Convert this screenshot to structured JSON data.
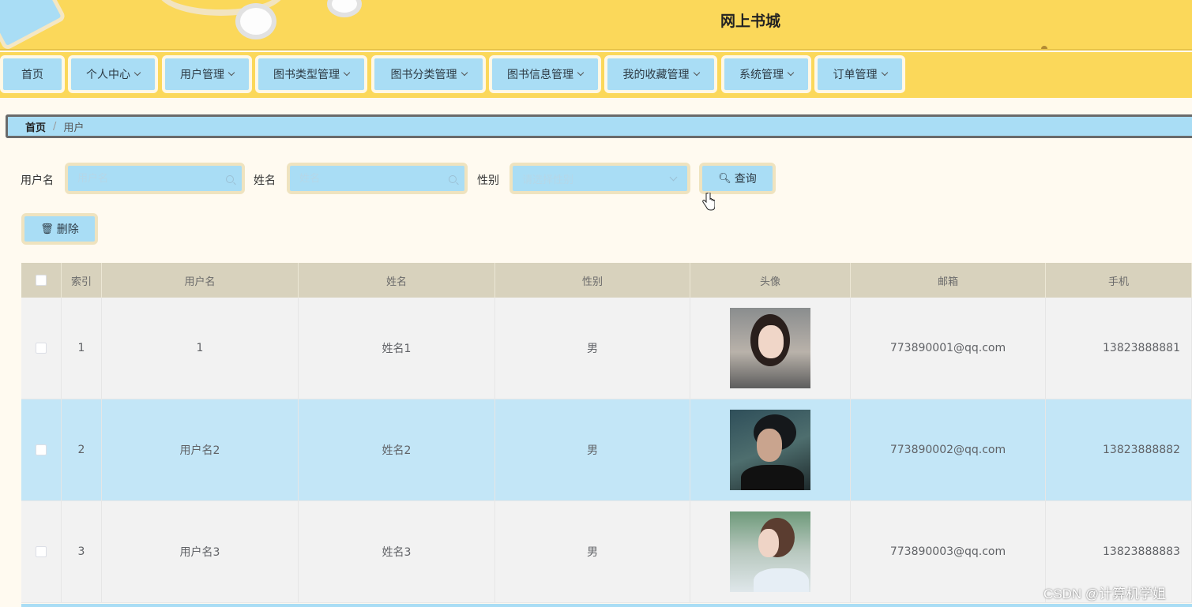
{
  "header": {
    "title": "网上书城"
  },
  "nav": [
    {
      "label": "首页",
      "dropdown": false
    },
    {
      "label": "个人中心",
      "dropdown": true
    },
    {
      "label": "用户管理",
      "dropdown": true
    },
    {
      "label": "图书类型管理",
      "dropdown": true
    },
    {
      "label": "图书分类管理",
      "dropdown": true
    },
    {
      "label": "图书信息管理",
      "dropdown": true
    },
    {
      "label": "我的收藏管理",
      "dropdown": true
    },
    {
      "label": "系统管理",
      "dropdown": true
    },
    {
      "label": "订单管理",
      "dropdown": true
    }
  ],
  "breadcrumb": {
    "home": "首页",
    "separator": "/",
    "current": "用户"
  },
  "search": {
    "username_label": "用户名",
    "username_placeholder": "用户名",
    "name_label": "姓名",
    "name_placeholder": "姓名",
    "gender_label": "性别",
    "gender_placeholder": "请选择性别",
    "query_button": "查询"
  },
  "actions": {
    "delete_button": "删除"
  },
  "table": {
    "headers": [
      "索引",
      "用户名",
      "姓名",
      "性别",
      "头像",
      "邮箱",
      "手机"
    ],
    "rows": [
      {
        "index": "1",
        "username": "1",
        "name": "姓名1",
        "gender": "男",
        "email": "773890001@qq.com",
        "phone": "13823888881"
      },
      {
        "index": "2",
        "username": "用户名2",
        "name": "姓名2",
        "gender": "男",
        "email": "773890002@qq.com",
        "phone": "13823888882"
      },
      {
        "index": "3",
        "username": "用户名3",
        "name": "姓名3",
        "gender": "男",
        "email": "773890003@qq.com",
        "phone": "13823888883"
      }
    ]
  },
  "watermark": "CSDN @计算机学姐",
  "colors": {
    "header_bg": "#fbd85a",
    "accent_blue": "#a9ddf5",
    "highlight_row": "#c3e6f7",
    "table_header": "#d8d2bd"
  }
}
